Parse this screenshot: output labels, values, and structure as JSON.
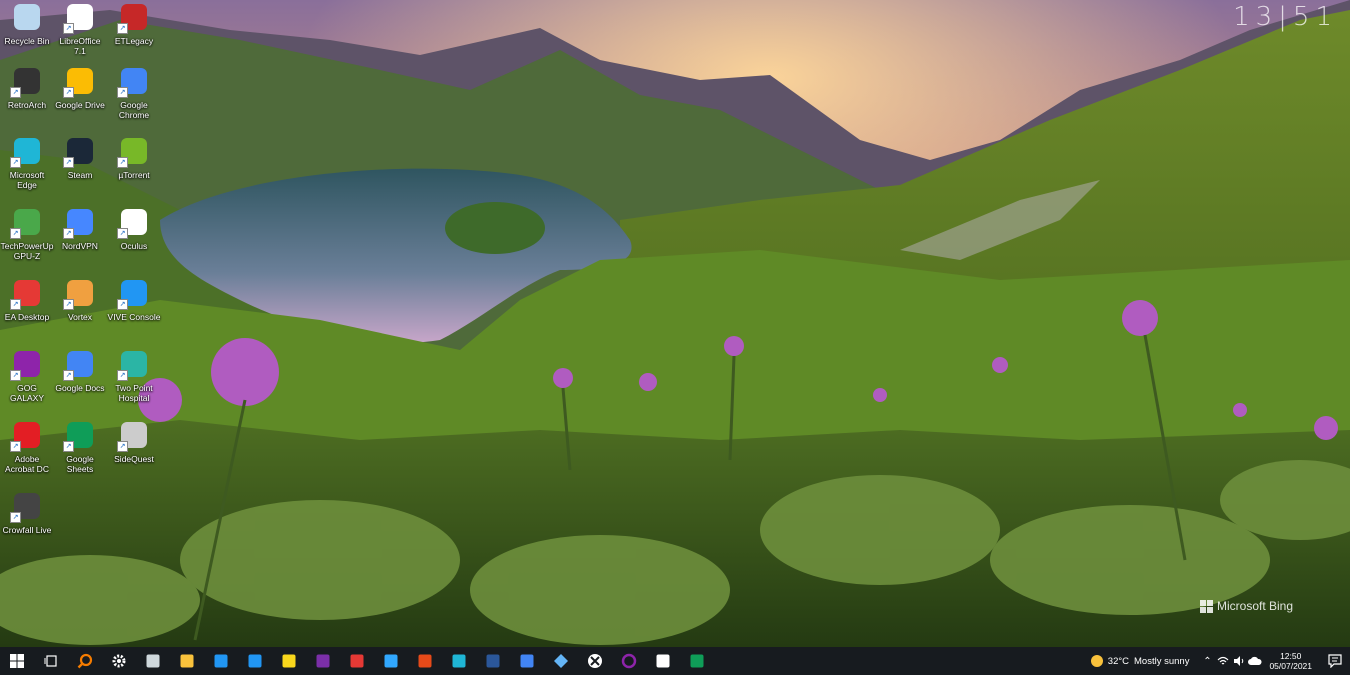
{
  "clock_widget": "13|51",
  "desktop_icons": [
    {
      "label": "Recycle Bin",
      "icon": "recycle-bin-icon",
      "color": "#b9d7ef"
    },
    {
      "label": "LibreOffice 7.1",
      "icon": "libreoffice-icon",
      "color": "#ffffff"
    },
    {
      "label": "ETLegacy",
      "icon": "etlegacy-icon",
      "color": "#c62828"
    },
    {
      "label": "RetroArch",
      "icon": "retroarch-icon",
      "color": "#333333"
    },
    {
      "label": "Google Drive",
      "icon": "google-drive-icon",
      "color": "#fbbc04"
    },
    {
      "label": "Google Chrome",
      "icon": "chrome-icon",
      "color": "#4285f4"
    },
    {
      "label": "Microsoft Edge",
      "icon": "edge-icon",
      "color": "#1fb6d6"
    },
    {
      "label": "Steam",
      "icon": "steam-icon",
      "color": "#1b2838"
    },
    {
      "label": "µTorrent",
      "icon": "utorrent-icon",
      "color": "#78b828"
    },
    {
      "label": "TechPowerUp GPU-Z",
      "icon": "gpuz-icon",
      "color": "#4aa84a"
    },
    {
      "label": "NordVPN",
      "icon": "nordvpn-icon",
      "color": "#4687ff"
    },
    {
      "label": "Oculus",
      "icon": "oculus-icon",
      "color": "#ffffff"
    },
    {
      "label": "EA Desktop",
      "icon": "ea-icon",
      "color": "#e53935"
    },
    {
      "label": "Vortex",
      "icon": "vortex-icon",
      "color": "#f0a040"
    },
    {
      "label": "VIVE Console",
      "icon": "vive-icon",
      "color": "#2196f3"
    },
    {
      "label": "GOG GALAXY",
      "icon": "gog-icon",
      "color": "#8e24aa"
    },
    {
      "label": "Google Docs",
      "icon": "google-docs-icon",
      "color": "#4285f4"
    },
    {
      "label": "Two Point Hospital",
      "icon": "two-point-hospital-icon",
      "color": "#2bb5a5"
    },
    {
      "label": "Adobe Acrobat DC",
      "icon": "acrobat-icon",
      "color": "#e31e24"
    },
    {
      "label": "Google Sheets",
      "icon": "google-sheets-icon",
      "color": "#0f9d58"
    },
    {
      "label": "SideQuest",
      "icon": "sidequest-icon",
      "color": "#cccccc"
    },
    {
      "label": "Crowfall Live",
      "icon": "crowfall-icon",
      "color": "#444444"
    }
  ],
  "watermark": "Microsoft Bing",
  "taskbar": {
    "apps": [
      {
        "name": "start-button",
        "icon": "windows-icon",
        "color": "#ffffff"
      },
      {
        "name": "task-view-button",
        "icon": "task-view-icon",
        "color": "#ffffff"
      },
      {
        "name": "search-button",
        "icon": "search-icon",
        "color": "#f57c00"
      },
      {
        "name": "settings-button",
        "icon": "gear-icon",
        "color": "#ffffff"
      },
      {
        "name": "app-cube-button",
        "icon": "cube-icon",
        "color": "#cfd8dc"
      },
      {
        "name": "file-explorer-button",
        "icon": "folder-icon",
        "color": "#f9c23c"
      },
      {
        "name": "mail-button",
        "icon": "mail-icon",
        "color": "#2196f3"
      },
      {
        "name": "people-button",
        "icon": "person-icon",
        "color": "#2196f3"
      },
      {
        "name": "sticky-notes-button",
        "icon": "sticky-note-icon",
        "color": "#f9d71c"
      },
      {
        "name": "onenote-button",
        "icon": "onenote-icon",
        "color": "#7b2fa8"
      },
      {
        "name": "paint-button",
        "icon": "paint-icon",
        "color": "#e53935"
      },
      {
        "name": "photoshop-button",
        "icon": "photoshop-icon",
        "color": "#31a8ff"
      },
      {
        "name": "office-button",
        "icon": "office-icon",
        "color": "#e64a19"
      },
      {
        "name": "edge-button",
        "icon": "edge-icon",
        "color": "#1fb6d6"
      },
      {
        "name": "word-button",
        "icon": "word-icon",
        "color": "#2b579a"
      },
      {
        "name": "docs-button",
        "icon": "docs-icon",
        "color": "#4285f4"
      },
      {
        "name": "vpn-button",
        "icon": "diamond-icon",
        "color": "#64b5f6"
      },
      {
        "name": "xbox-button",
        "icon": "xbox-icon",
        "color": "#ffffff"
      },
      {
        "name": "gog-button",
        "icon": "gog-ring-icon",
        "color": "#8e24aa"
      },
      {
        "name": "steam-button",
        "icon": "steam-icon",
        "color": "#ffffff"
      },
      {
        "name": "sheets-button",
        "icon": "sheets-icon",
        "color": "#0f9d58"
      }
    ],
    "weather": {
      "temp": "32°C",
      "condition": "Mostly sunny"
    },
    "time": "12:50",
    "date": "05/07/2021"
  }
}
